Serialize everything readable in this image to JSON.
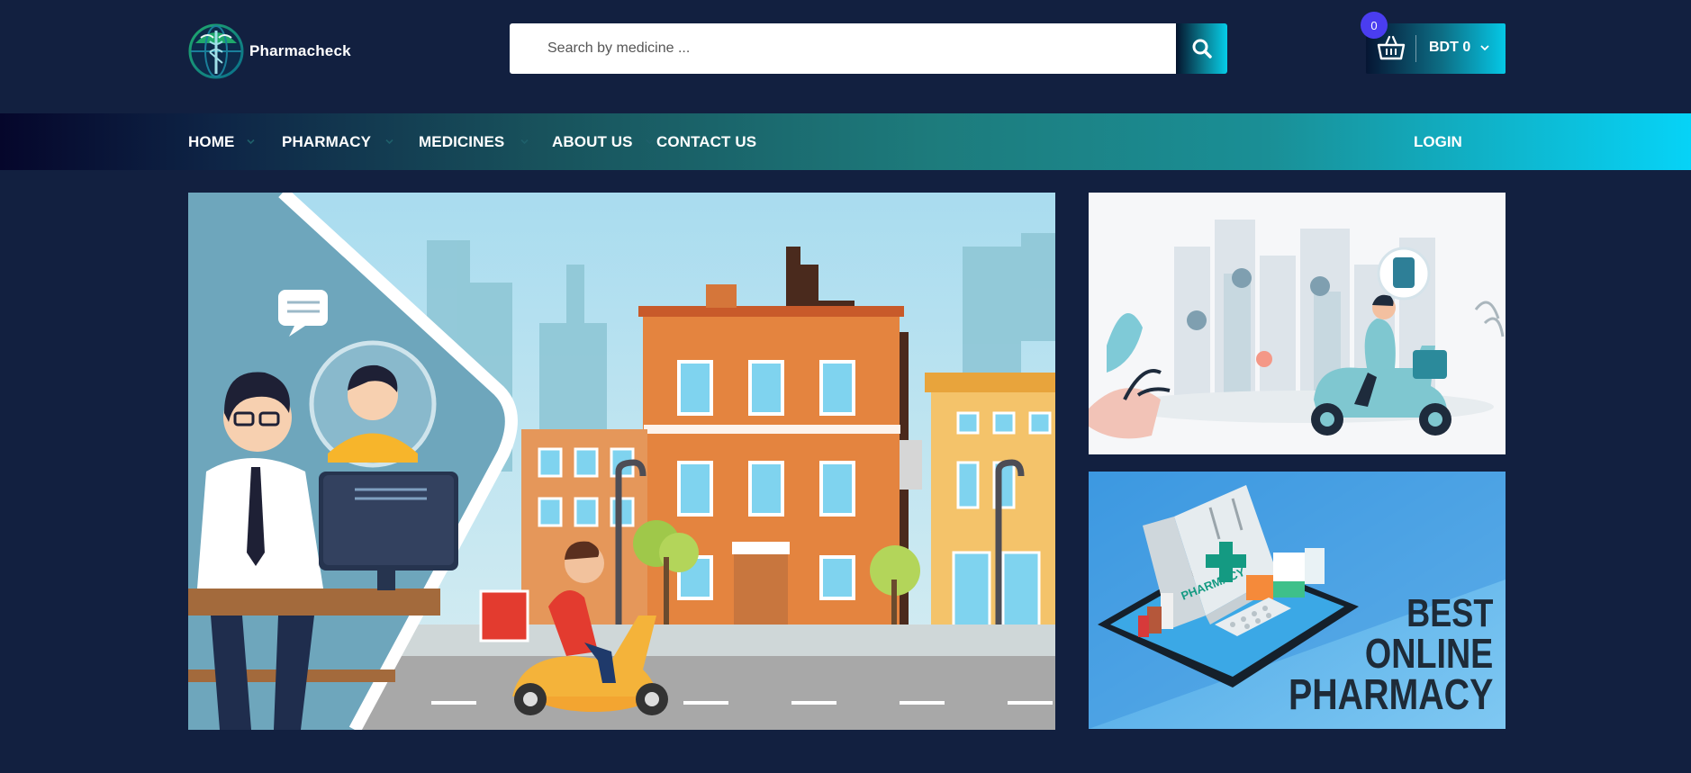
{
  "brand": {
    "name": "Pharmacheck",
    "logo_icon": "caduceus-globe-icon"
  },
  "search": {
    "placeholder": "Search by medicine ...",
    "button_icon": "search-icon"
  },
  "cart": {
    "count": "0",
    "total": "BDT 0",
    "icon": "basket-icon"
  },
  "nav": {
    "items": [
      {
        "label": "HOME"
      },
      {
        "label": "PHARMACY"
      },
      {
        "label": "MEDICINES"
      },
      {
        "label": "ABOUT US"
      },
      {
        "label": "CONTACT US"
      }
    ],
    "login": "LOGIN"
  },
  "banners": {
    "side_bottom": {
      "line1": "BEST",
      "line2": "ONLINE",
      "line3": "PHARMACY",
      "bag_label": "PHARMACY"
    }
  },
  "colors": {
    "background": "#122040",
    "accent": "#05cde8",
    "badge": "#4a3df0"
  }
}
